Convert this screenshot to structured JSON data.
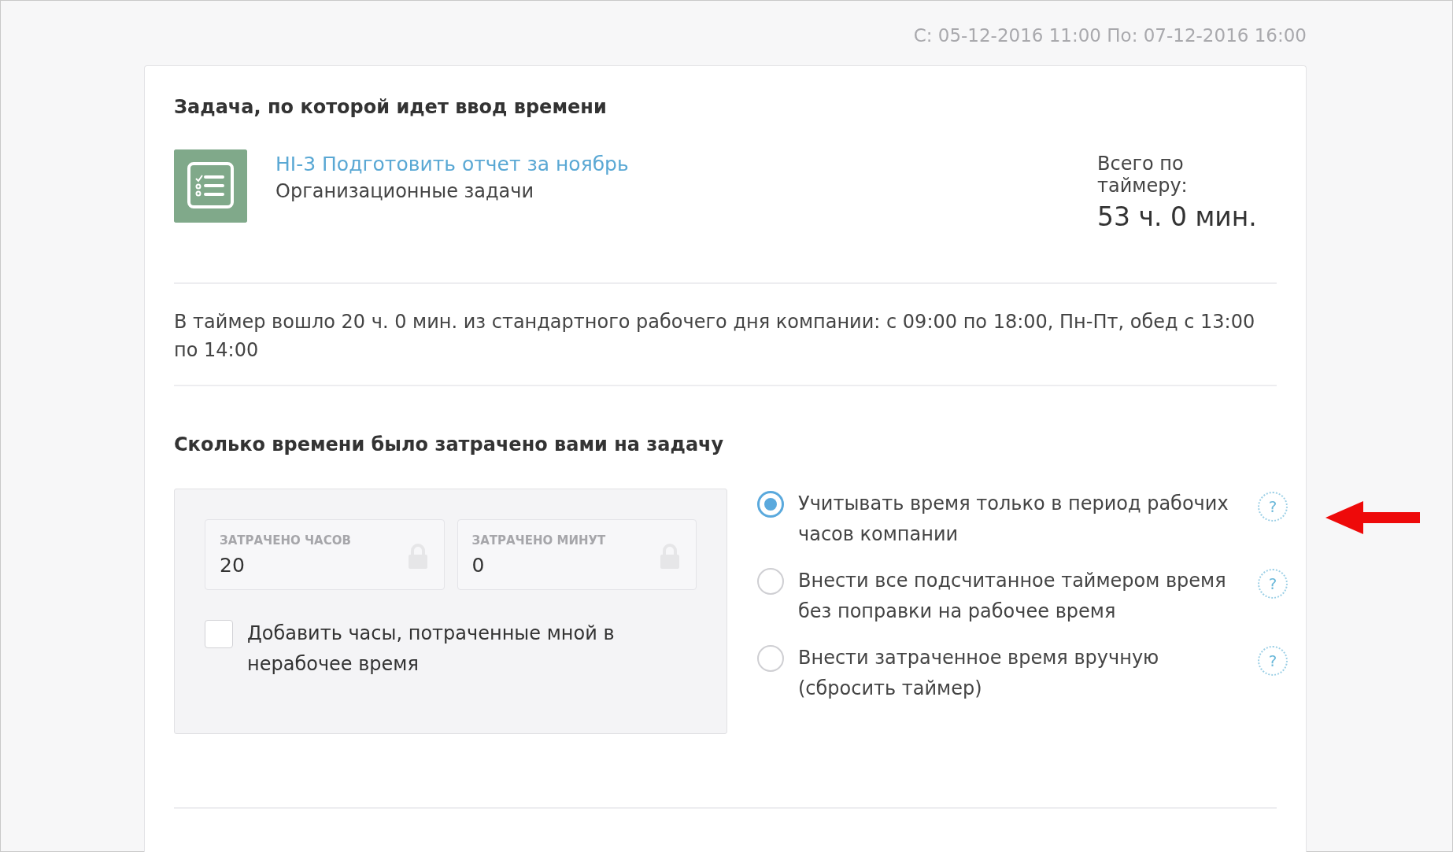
{
  "period": "С: 05-12-2016 11:00 По: 07-12-2016 16:00",
  "task_section": {
    "title": "Задача, по которой идет ввод времени",
    "task_link": "HI-3 Подготовить отчет за ноябрь",
    "project": "Организационные задачи",
    "timer_label": "Всего по таймеру:",
    "timer_total": "53 ч. 0 мин."
  },
  "timer_note": "В таймер вошло 20 ч. 0 мин. из стандартного рабочего дня компании: с 09:00 по 18:00, Пн-Пт, обед с 13:00 по 14:00",
  "spent_section": {
    "title": "Сколько времени было затрачено вами на задачу",
    "fields": [
      {
        "label": "ЗАТРАЧЕНО ЧАСОВ",
        "value": "20",
        "locked": true
      },
      {
        "label": "ЗАТРАЧЕНО МИНУТ",
        "value": "0",
        "locked": true
      }
    ],
    "checkbox": {
      "label": "Добавить часы, потраченные мной в нерабочее время",
      "checked": false
    },
    "options": [
      {
        "label": "Учитывать время только в период рабочих часов компании",
        "selected": true,
        "help": "?"
      },
      {
        "label": "Внести все подсчитанное таймером время без поправки на рабочее время",
        "selected": false,
        "help": "?"
      },
      {
        "label": "Внести затраченное время вручную (сбросить таймер)",
        "selected": false,
        "help": "?"
      }
    ]
  }
}
